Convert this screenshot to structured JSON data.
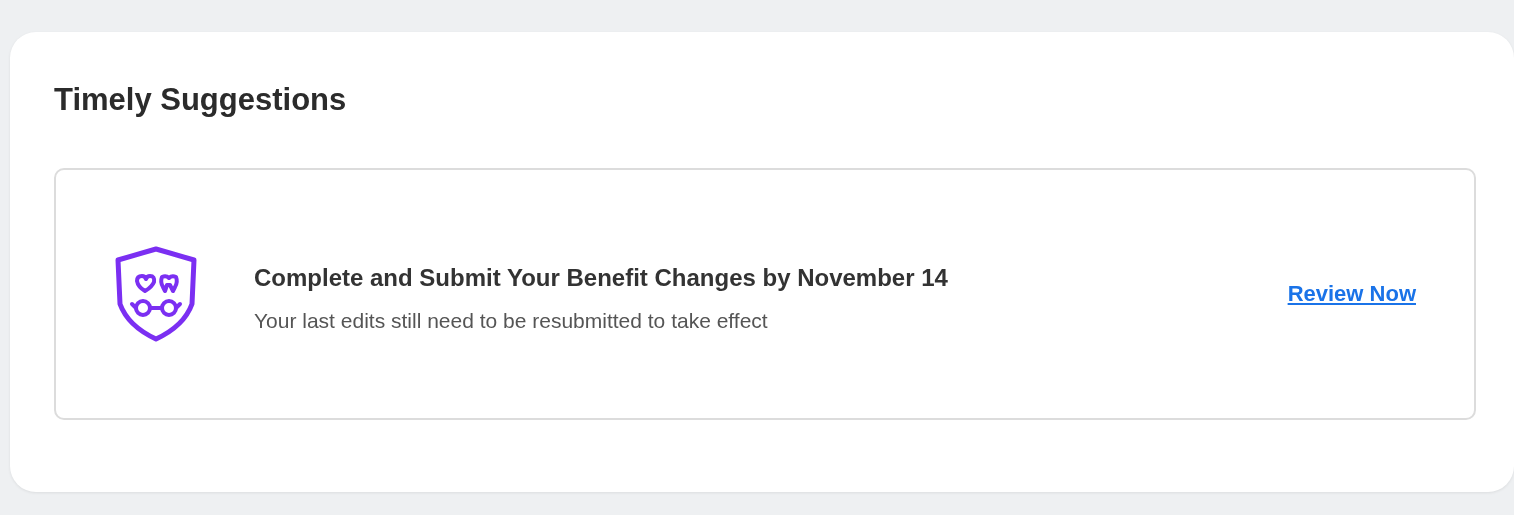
{
  "section": {
    "title": "Timely Suggestions"
  },
  "suggestions": [
    {
      "title": "Complete and Submit Your Benefit Changes by November 14",
      "description": "Your last edits still need to be resubmitted to take effect",
      "action": "Review Now"
    }
  ]
}
